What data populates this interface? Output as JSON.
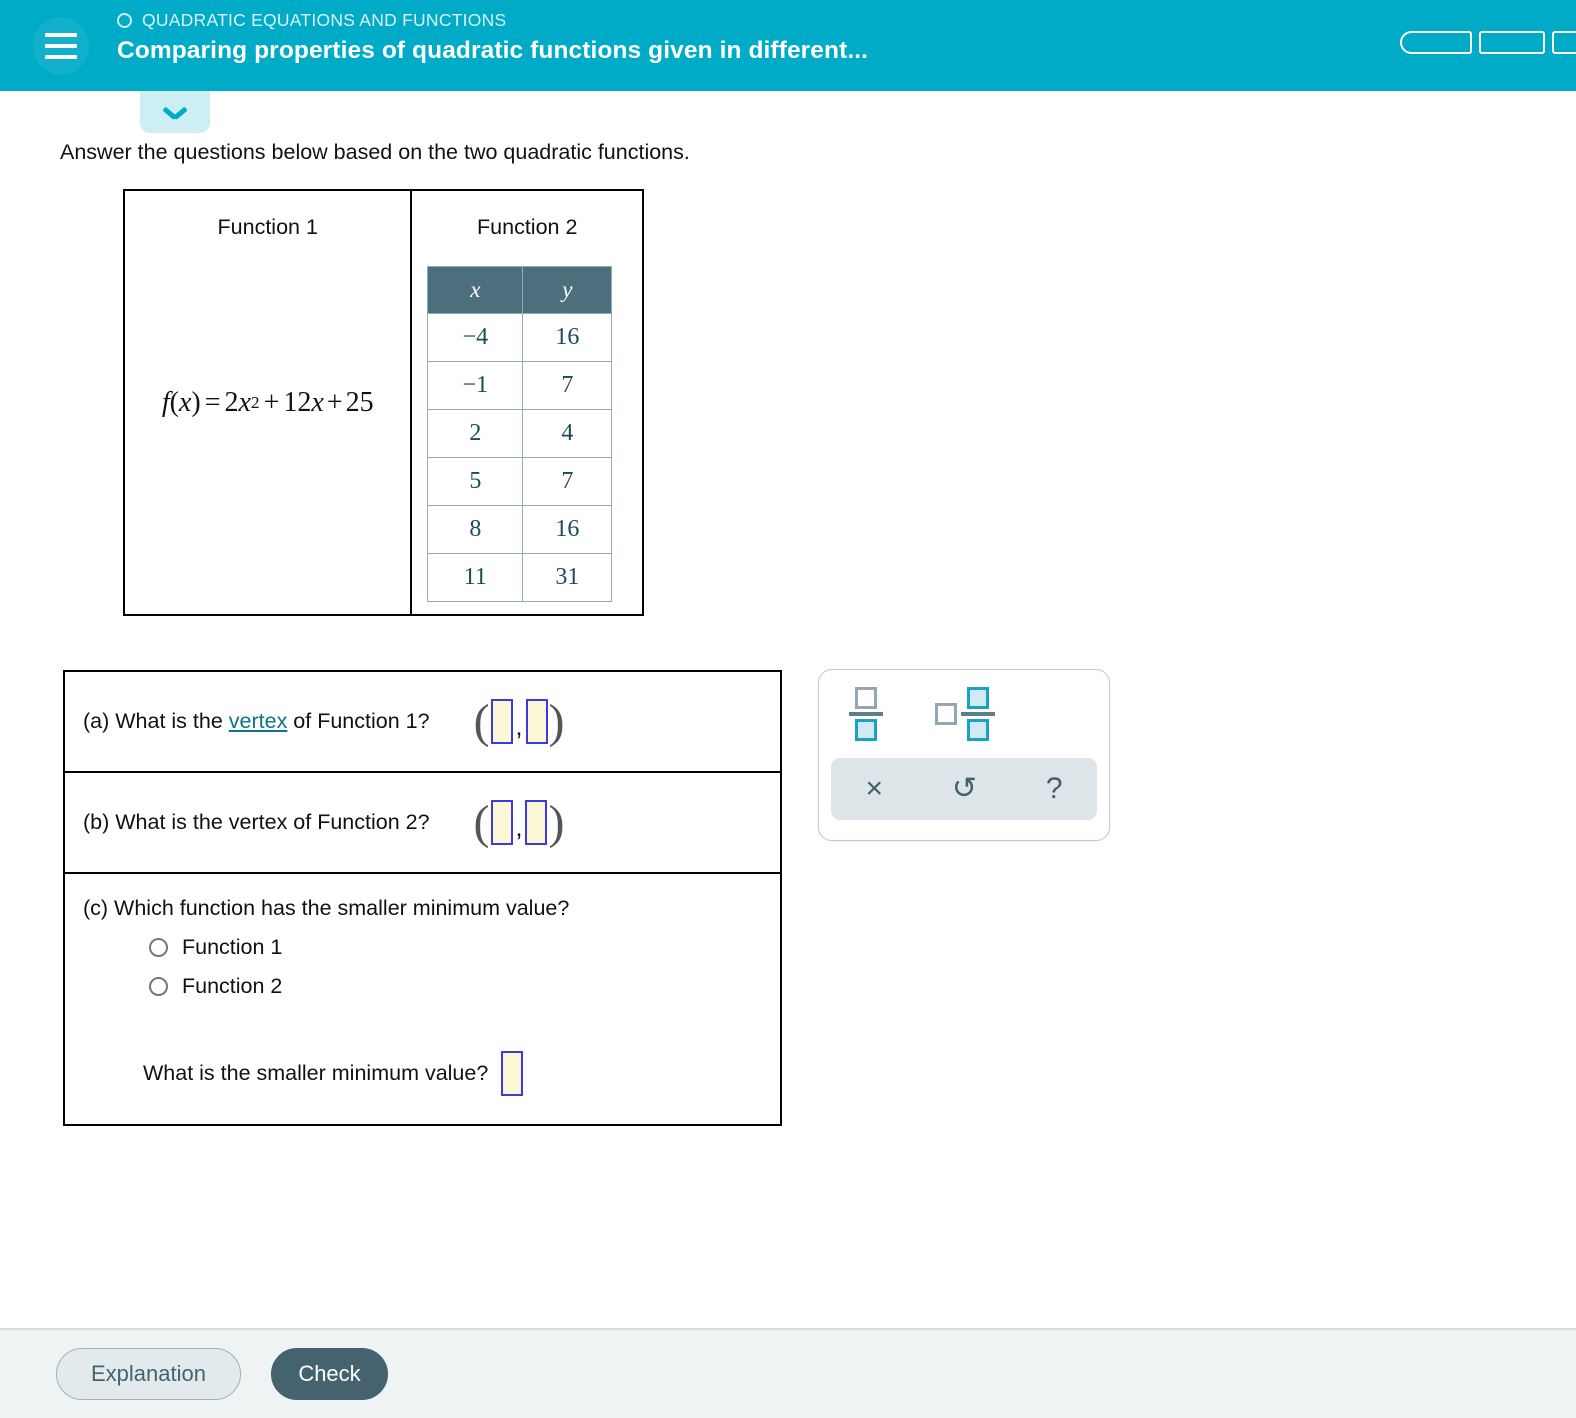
{
  "header": {
    "menu_icon": "hamburger-icon",
    "eyebrow_icon": "circle-outline-icon",
    "eyebrow": "QUADRATIC EQUATIONS AND FUNCTIONS",
    "title": "Comparing properties of quadratic functions given in different...",
    "accent_color": "#00ABC8",
    "progress_segments": 3
  },
  "collapse_tab": {
    "icon": "chevron-down-icon",
    "background": "#cdeef4"
  },
  "prompt": "Answer the questions below based on the two quadratic functions.",
  "function_table": {
    "col1_header": "Function 1",
    "col2_header": "Function 2",
    "function1_equation_prefix": "f",
    "function1_equation": "f(x) = 2x² + 12x + 25",
    "eq_parts": {
      "fname": "f",
      "open": "(",
      "var": "x",
      "close": ")",
      "equals": "=",
      "c1": "2",
      "v1": "x",
      "exp": "2",
      "plus1": "+",
      "c2": "12",
      "v2": "x",
      "plus2": "+",
      "c3": "25"
    },
    "header_bg": "#4C6F7D",
    "columns": [
      "x",
      "y"
    ],
    "rows": [
      [
        "−4",
        "16"
      ],
      [
        "−1",
        "7"
      ],
      [
        "2",
        "4"
      ],
      [
        "5",
        "7"
      ],
      [
        "8",
        "16"
      ],
      [
        "11",
        "31"
      ]
    ]
  },
  "questions": {
    "a": {
      "label": "(a) What is the ",
      "link": "vertex",
      "label_after": " of Function 1?",
      "open_paren": "(",
      "comma": ",",
      "close_paren": ")",
      "answer_x": "",
      "answer_y": ""
    },
    "b": {
      "label": "(b) What is the vertex of Function 2?",
      "open_paren": "(",
      "comma": ",",
      "close_paren": ")",
      "answer_x": "",
      "answer_y": ""
    },
    "c": {
      "label": "(c) Which function has the smaller minimum value?",
      "options": [
        "Function 1",
        "Function 2"
      ],
      "selected": "",
      "subquestion": "What is the smaller minimum value?",
      "sub_answer": ""
    }
  },
  "math_toolbar": {
    "buttons": [
      {
        "name": "fraction-icon",
        "glyph": ""
      },
      {
        "name": "mixed-number-icon",
        "glyph": ""
      }
    ],
    "actions": [
      {
        "name": "clear-icon",
        "glyph": "×"
      },
      {
        "name": "undo-icon",
        "glyph": "↺"
      },
      {
        "name": "help-icon",
        "glyph": "?"
      }
    ],
    "panel_bg": "#dde5e8"
  },
  "footer": {
    "explanation_label": "Explanation",
    "check_label": "Check",
    "check_color": "#44636F"
  }
}
